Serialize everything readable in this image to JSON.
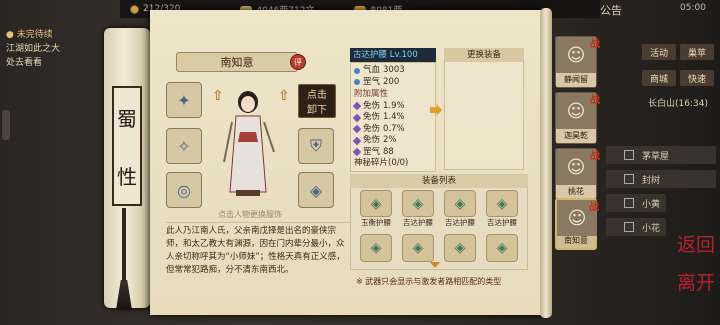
{
  "topbar": {
    "time_gauge": "212/320",
    "silver": "4046两712文",
    "gold": "8081两",
    "notice": "公告",
    "clock": "05:00"
  },
  "quest": {
    "title": "● 未完待续",
    "desc1": "江湖如此之大",
    "desc2": "处去看看"
  },
  "sect": {
    "c1": "蜀",
    "c2": "性"
  },
  "character": {
    "name": "南知意",
    "rate_badge": "评",
    "tap_line1": "点击",
    "tap_line2": "卸下",
    "hint": "点击人物更换服饰",
    "bio": "此人乃江南人氏，父亲南戊择是出名的豪侠宗师，和太乙教大有渊源，因在门内辈分最小，众人亲切称呼其为“小师妹”；性格天真有正义感，但常常犯路痴，分不清东南西北。"
  },
  "equip": {
    "name": "古达护腰 Lv.100",
    "base": [
      {
        "label": "气血",
        "value": "3003"
      },
      {
        "label": "罡气",
        "value": "200"
      }
    ],
    "extra_title": "附加属性",
    "extra": [
      {
        "label": "免伤",
        "value": "1.9%"
      },
      {
        "label": "免伤",
        "value": "1.4%"
      },
      {
        "label": "免伤",
        "value": "0.7%"
      },
      {
        "label": "免伤",
        "value": "2%"
      },
      {
        "label": "罡气",
        "value": "88"
      }
    ],
    "more": "神秘碎片(0/0)",
    "change_title": "更换装备"
  },
  "list": {
    "title": "装备列表",
    "items": [
      "玉衡护腰",
      "吉达护腰",
      "吉达护腰",
      "吉达护腰",
      "",
      "",
      "",
      ""
    ],
    "note": "※ 武器只会显示与激发者路相匹配的类型"
  },
  "party": [
    {
      "name": "静闻留",
      "ready": "战"
    },
    {
      "name": "迦昊乾",
      "ready": "战"
    },
    {
      "name": "桃花",
      "ready": "战"
    },
    {
      "name": "南知意",
      "ready": "战"
    }
  ],
  "menu": {
    "activity": "活动",
    "store": "商城",
    "bag": "巢苹",
    "quick": "快速",
    "location": "长白山",
    "coords": "(16:34)",
    "bars": [
      "茅草屋",
      "封树",
      "小黄",
      "小花"
    ]
  },
  "back": {
    "line1": "返回",
    "line2": "离开"
  }
}
